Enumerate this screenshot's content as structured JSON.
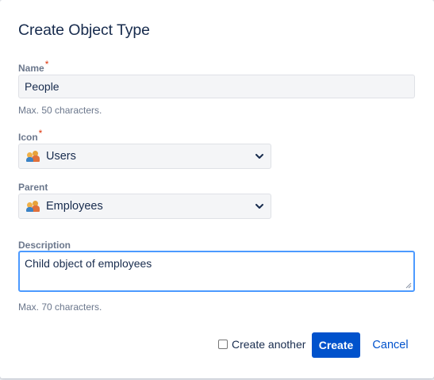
{
  "dialog": {
    "title": "Create Object Type"
  },
  "fields": {
    "name": {
      "label": "Name",
      "required_mark": "*",
      "value": "People",
      "help": "Max. 50 characters."
    },
    "icon": {
      "label": "Icon",
      "required_mark": "*",
      "selected": "Users",
      "icon_name": "users-icon"
    },
    "parent": {
      "label": "Parent",
      "selected": "Employees",
      "icon_name": "users-icon"
    },
    "description": {
      "label": "Description",
      "value": "Child object of employees",
      "help": "Max. 70 characters."
    }
  },
  "footer": {
    "create_another_label": "Create another",
    "create_another_checked": false,
    "create_label": "Create",
    "cancel_label": "Cancel"
  },
  "colors": {
    "primary": "#0052cc",
    "focus_border": "#4c9aff",
    "required": "#de350b",
    "label": "#6b778c",
    "text": "#172b4d"
  }
}
